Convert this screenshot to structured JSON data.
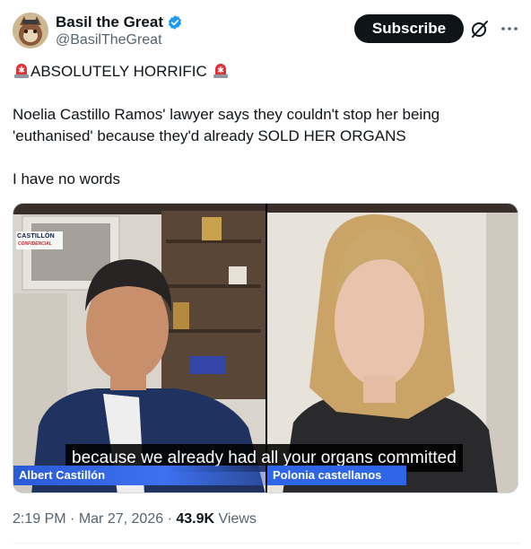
{
  "author": {
    "display_name": "Basil the Great",
    "handle": "@BasilTheGreat",
    "verified": true
  },
  "actions": {
    "subscribe_label": "Subscribe"
  },
  "tweet": {
    "headline": "ABSOLUTELY HORRIFIC",
    "body_line1": "Noelia Castillo Ramos' lawyer says they couldn't stop her being",
    "body_line2": "'euthanised' because they'd already SOLD HER ORGANS",
    "body_line3": "I have no words"
  },
  "media": {
    "caption": "because we already had all your organs committed",
    "left_name": "Albert Castillón",
    "right_name": "Polonia castellanos",
    "logo_line1": "CASTILLÓN",
    "logo_line2": "CONFIDENCIAL"
  },
  "meta": {
    "time": "2:19 PM",
    "date": "Mar 27, 2026",
    "views_count": "43.9K",
    "views_label": "Views"
  },
  "colors": {
    "text": "#0f1419",
    "muted": "#536471",
    "verified": "#1d9bf0",
    "name_tag": "#2f66e8"
  },
  "icons": [
    "verified-badge-icon",
    "grok-icon",
    "more-icon",
    "siren-icon"
  ]
}
